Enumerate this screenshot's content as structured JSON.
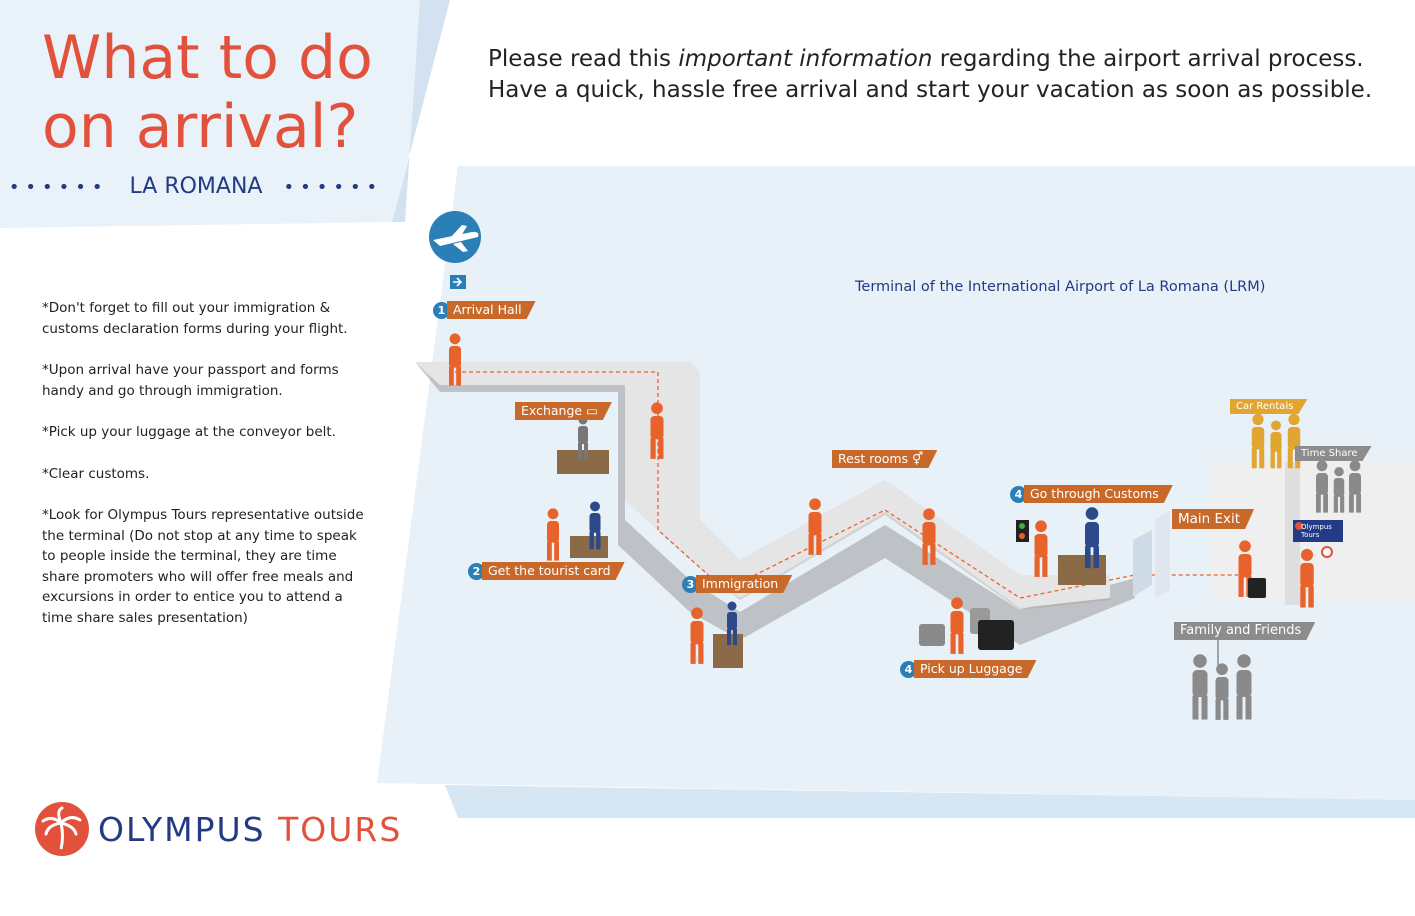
{
  "header": {
    "title_line1": "What to do",
    "title_line2": "on arrival?",
    "city": "LA ROMANA",
    "dots": "••••••"
  },
  "intro": {
    "line1_prefix": "Please read this ",
    "line1_em": "important information",
    "line1_suffix": " regarding the airport arrival process.",
    "line2": "Have a quick, hassle free arrival and start your vacation as soon as possible."
  },
  "notes": [
    "*Don't forget to fill out your immigration & customs declaration forms during your flight.",
    "*Upon arrival have your passport and forms handy and go through immigration.",
    "*Pick up your luggage at the conveyor belt.",
    "*Clear customs.",
    "*Look for Olympus Tours representative outside the terminal (Do not stop at any time to speak to people inside the terminal, they are time share promoters who will offer free meals and excursions in order to entice you to attend a time share sales presentation)"
  ],
  "map": {
    "title": "Terminal of the International Airport of La Romana (LRM)",
    "labels": {
      "arrival_hall": "Arrival Hall",
      "exchange": "Exchange",
      "tourist_card": "Get the tourist card",
      "immigration": "Immigration",
      "rest_rooms": "Rest rooms",
      "customs": "Go through Customs",
      "luggage": "Pick up Luggage",
      "main_exit": "Main Exit",
      "car_rentals": "Car Rentals",
      "time_share": "Time Share",
      "family": "Family and Friends",
      "olympus_sign": "Olympus Tours"
    },
    "steps": {
      "s1": "1",
      "s2": "2",
      "s3": "3",
      "s4a": "4",
      "s4b": "4"
    }
  },
  "brand": {
    "part1": "OLYMPUS ",
    "part2": "TOURS"
  },
  "colors": {
    "title": "#e2513c",
    "navy": "#233a84",
    "orange": "#c8692a",
    "gold": "#e2a630",
    "panel": "#e8f0f8"
  },
  "icons": [
    "plane-icon",
    "arrow-icon",
    "money-icon",
    "restroom-icon",
    "palm-tree-logo-icon"
  ]
}
